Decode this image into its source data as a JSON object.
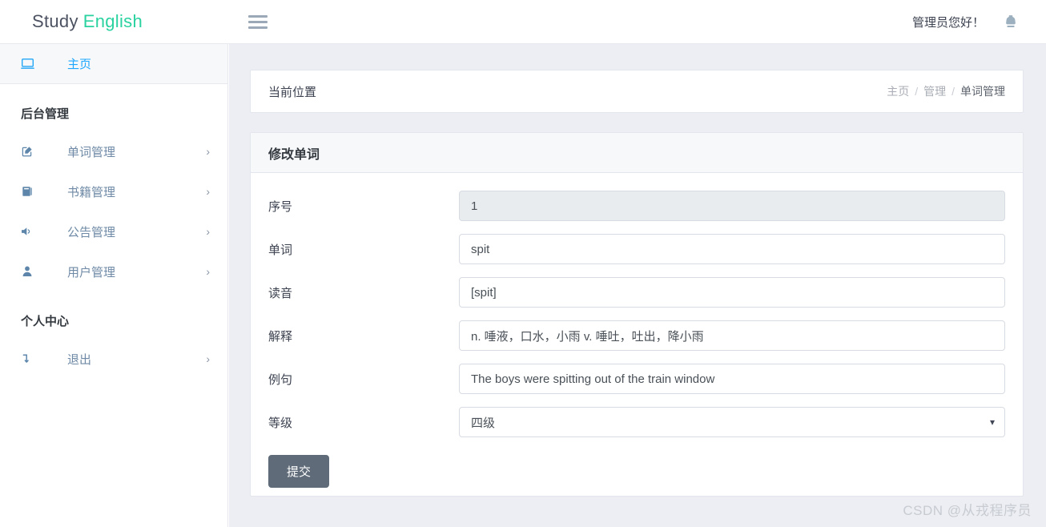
{
  "navbar": {
    "brand_primary": "Study",
    "brand_accent": "English",
    "menu_icon": "hamburger-icon",
    "greeting": "管理员您好！",
    "user_icon": "user-bust-icon"
  },
  "sidebar": {
    "home": {
      "label": "主页",
      "icon": "monitor-icon",
      "active": true
    },
    "section_admin": "后台管理",
    "admin_items": [
      {
        "label": "单词管理",
        "icon": "pencil-square-icon",
        "arrow": "›"
      },
      {
        "label": "书籍管理",
        "icon": "book-icon",
        "arrow": "›"
      },
      {
        "label": "公告管理",
        "icon": "megaphone-icon",
        "arrow": "›"
      },
      {
        "label": "用户管理",
        "icon": "user-icon",
        "arrow": "›"
      }
    ],
    "section_personal": "个人中心",
    "personal_items": [
      {
        "label": "退出",
        "icon": "logout-icon",
        "arrow": "›"
      }
    ]
  },
  "breadcrumb": {
    "title": "当前位置",
    "items": [
      "主页",
      "管理",
      "单词管理"
    ],
    "separator": "/"
  },
  "form": {
    "panel_title": "修改单词",
    "fields": [
      {
        "label": "序号",
        "value": "1",
        "type": "text",
        "disabled": true
      },
      {
        "label": "单词",
        "value": "spit",
        "type": "text",
        "disabled": false
      },
      {
        "label": "读音",
        "value": "[spit]",
        "type": "text",
        "disabled": false
      },
      {
        "label": "解释",
        "value": "n. 唾液，口水，小雨 v. 唾吐，吐出，降小雨",
        "type": "text",
        "disabled": false
      },
      {
        "label": "例句",
        "value": "The boys were spitting out of the train window",
        "type": "text",
        "disabled": false
      },
      {
        "label": "等级",
        "value": "四级",
        "type": "select",
        "disabled": false
      }
    ],
    "submit_label": "提交"
  },
  "watermark": "CSDN @从戎程序员",
  "colors": {
    "brand_accent": "#2ad2a0",
    "active_blue": "#1ea7fd",
    "content_bg": "#eceef3",
    "submit_btn": "#5f6b78",
    "disabled_field": "#e9ecef"
  }
}
